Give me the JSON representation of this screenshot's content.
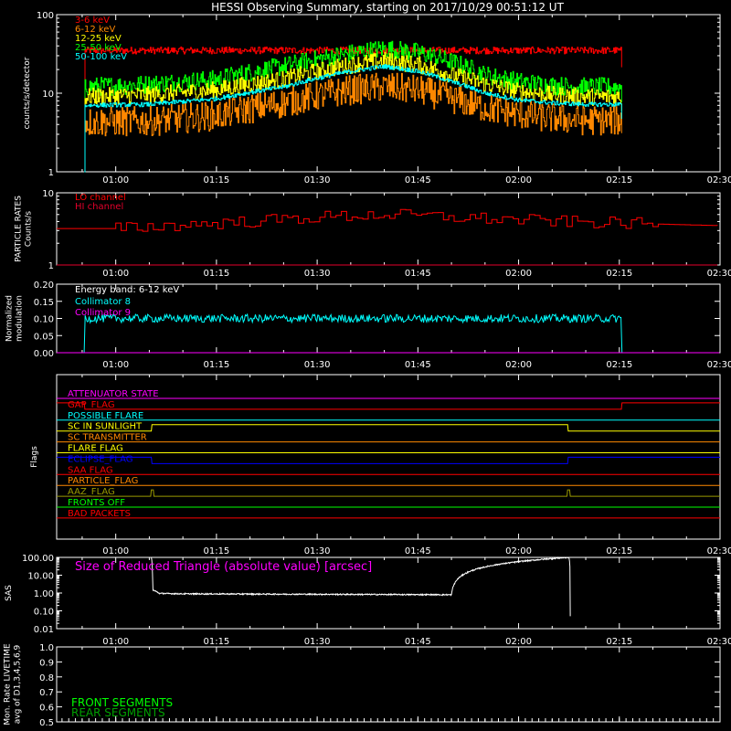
{
  "title": "HESSI Observing Summary, starting on 2017/10/29 00:51:12 UT",
  "time_axis": {
    "start": "00:51:12",
    "end": "02:30",
    "ticks": [
      "01:00",
      "01:15",
      "01:30",
      "01:45",
      "02:00",
      "02:15",
      "02:30"
    ],
    "tick_minutes": [
      60,
      75,
      90,
      105,
      120,
      135,
      150
    ],
    "range_minutes": [
      51.2,
      150
    ]
  },
  "colors": {
    "background": "#000000",
    "axis": "#ffffff",
    "red": "#ff0000",
    "orange": "#ff8800",
    "yellow": "#ffff00",
    "green": "#00ff00",
    "cyan": "#00ffff",
    "magenta": "#ff00ff",
    "crimson": "#e4002b",
    "blue": "#0000ff",
    "olive": "#9a9a00",
    "darkgreen": "#00a000"
  },
  "chart_data": [
    {
      "id": "count-rates",
      "type": "line",
      "ylabel": "counts/s/detector",
      "yscale": "log",
      "ylim": [
        1,
        100
      ],
      "yticks": [
        "1",
        "10",
        "100"
      ],
      "series": [
        {
          "name": "3-6 keV",
          "color": "#ff0000",
          "x": [
            55.3,
            55.4,
            130,
            135.3,
            135.4
          ],
          "y": [
            1,
            35,
            35,
            35,
            1
          ],
          "noise": 0.08
        },
        {
          "name": "6-12 keV",
          "color": "#ff8800",
          "x": [
            55.3,
            55.4,
            65,
            75,
            85,
            95,
            100,
            105,
            110,
            115,
            120,
            125,
            130,
            135.3,
            135.4
          ],
          "y": [
            1,
            4.3,
            4.4,
            5.2,
            7.5,
            11,
            12,
            11,
            8.5,
            6.5,
            5.4,
            4.8,
            4.5,
            4.5,
            1
          ],
          "noise": 0.35
        },
        {
          "name": "12-25 keV",
          "color": "#ffff00",
          "x": [
            55.3,
            55.4,
            65,
            75,
            85,
            95,
            100,
            105,
            110,
            115,
            120,
            125,
            130,
            135.3,
            135.4
          ],
          "y": [
            1,
            9,
            9.5,
            11,
            15,
            23,
            26,
            23,
            17,
            13,
            10.5,
            9.5,
            9,
            9,
            1
          ],
          "noise": 0.2
        },
        {
          "name": "25-50 keV",
          "color": "#00ff00",
          "x": [
            55.3,
            55.4,
            65,
            75,
            85,
            95,
            100,
            105,
            110,
            115,
            120,
            125,
            130,
            135.3,
            135.4
          ],
          "y": [
            1,
            12,
            13,
            15,
            22,
            32,
            37,
            33,
            25,
            17,
            14,
            12.5,
            12,
            12,
            1
          ],
          "noise": 0.22
        },
        {
          "name": "50-100 keV",
          "color": "#00ffff",
          "x": [
            55.3,
            55.4,
            65,
            75,
            85,
            95,
            100,
            105,
            110,
            115,
            120,
            125,
            130,
            135.3,
            135.4
          ],
          "y": [
            1,
            7,
            7.2,
            8.5,
            12,
            19,
            22,
            19,
            14,
            10,
            8.2,
            7.5,
            7.2,
            7.2,
            1
          ],
          "noise": 0.05
        }
      ]
    },
    {
      "id": "particle-rates",
      "type": "line",
      "ylabel": "PARTICLE RATES Counts/s",
      "ylabel_lines": [
        "PARTICLE RATES",
        "Counts/s"
      ],
      "yscale": "log",
      "ylim": [
        1,
        10
      ],
      "yticks": [
        "1",
        "10"
      ],
      "series": [
        {
          "name": "LO channel",
          "color": "#ff0000",
          "x": [
            51.2,
            60,
            65,
            70,
            80,
            90,
            100,
            110,
            120,
            130,
            140,
            150
          ],
          "y": [
            3.2,
            3.2,
            3.4,
            3.6,
            4.0,
            4.6,
            5.0,
            4.6,
            4.2,
            3.9,
            3.7,
            3.5
          ],
          "noise": 0.15
        },
        {
          "name": "HI channel",
          "color": "#e4002b",
          "x": [
            51.2,
            150
          ],
          "y": [
            1,
            1
          ]
        }
      ]
    },
    {
      "id": "modulation",
      "type": "line",
      "ylabel": "Normalized modulation",
      "ylabel_lines": [
        "Normalized",
        "modulation"
      ],
      "ylim": [
        0,
        0.2
      ],
      "yticks": [
        "0.00",
        "0.05",
        "0.10",
        "0.15",
        "0.20"
      ],
      "yvalues": [
        0,
        0.05,
        0.1,
        0.15,
        0.2
      ],
      "energy_band": "Energy band: 6-12 keV",
      "series": [
        {
          "name": "Collimator 8",
          "color": "#00ffff",
          "x": [
            55.3,
            55.4,
            135.3,
            135.4
          ],
          "y": [
            0,
            0.1,
            0.1,
            0
          ],
          "noise": 0.012
        },
        {
          "name": "Collimator 9",
          "color": "#ff00ff",
          "x": [
            51.2,
            150
          ],
          "y": [
            0,
            0
          ]
        }
      ]
    },
    {
      "id": "flags",
      "type": "line",
      "ylabel": "Flags",
      "series": [
        {
          "name": "ATTENUATOR STATE",
          "color": "#ff00ff",
          "x": [
            51.2,
            150
          ],
          "y": [
            0,
            0
          ]
        },
        {
          "name": "GAP_FLAG",
          "color": "#ff0000",
          "x": [
            51.2,
            55.3,
            55.4,
            135.3,
            135.4,
            150
          ],
          "y": [
            1,
            1,
            0,
            0,
            1,
            1
          ]
        },
        {
          "name": "POSSIBLE FLARE",
          "color": "#00ffff",
          "x": [
            51.2,
            150
          ],
          "y": [
            0,
            0
          ]
        },
        {
          "name": "SC IN SUNLIGHT",
          "color": "#ffff00",
          "x": [
            51.2,
            65.3,
            65.4,
            127.3,
            127.4,
            150
          ],
          "y": [
            0,
            0,
            1,
            1,
            0,
            0
          ]
        },
        {
          "name": "SC TRANSMITTER",
          "color": "#ff8800",
          "x": [
            51.2,
            150
          ],
          "y": [
            0,
            0
          ]
        },
        {
          "name": "FLARE FLAG",
          "color": "#ffff00",
          "x": [
            51.2,
            150
          ],
          "y": [
            0,
            0
          ]
        },
        {
          "name": "ECLIPSE_FLAG",
          "color": "#0000ff",
          "x": [
            51.2,
            65.3,
            65.4,
            127.3,
            127.4,
            150
          ],
          "y": [
            1,
            1,
            0,
            0,
            1,
            1
          ]
        },
        {
          "name": "SAA FLAG",
          "color": "#ff0000",
          "x": [
            51.2,
            150
          ],
          "y": [
            0,
            0
          ]
        },
        {
          "name": "PARTICLE_FLAG",
          "color": "#ff8800",
          "x": [
            51.2,
            150
          ],
          "y": [
            0,
            0
          ]
        },
        {
          "name": "AAZ_FLAG",
          "color": "#9a9a00",
          "x": [
            51.2,
            65.2,
            65.3,
            65.6,
            65.7,
            127.2,
            127.3,
            127.6,
            127.7,
            150
          ],
          "y": [
            0,
            0,
            1,
            1,
            0,
            0,
            1,
            1,
            0,
            0
          ]
        },
        {
          "name": "FRONTS OFF",
          "color": "#00ff00",
          "x": [
            51.2,
            150
          ],
          "y": [
            0,
            0
          ]
        },
        {
          "name": "BAD PACKETS",
          "color": "#ff0000",
          "x": [
            51.2,
            150
          ],
          "y": [
            0,
            0
          ]
        }
      ]
    },
    {
      "id": "sas",
      "type": "line",
      "ylabel": "SAS",
      "yscale": "log",
      "ylim": [
        0.01,
        100
      ],
      "yticks": [
        "0.01",
        "0.10",
        "1.00",
        "10.00",
        "100.00"
      ],
      "yvalues": [
        0.01,
        0.1,
        1,
        10,
        100
      ],
      "annotation": "Size of Reduced Triangle (absolute value) [arcsec]",
      "series": [
        {
          "name": "Size of Reduced Triangle",
          "color": "#ffffff",
          "x": [
            65.3,
            65.5,
            66.5,
            70,
            90,
            110,
            127.5,
            127.7
          ],
          "y": [
            100,
            1.5,
            0.95,
            0.9,
            0.85,
            0.8,
            100,
            0.05
          ],
          "noise": 0.06
        }
      ]
    },
    {
      "id": "livetime",
      "type": "line",
      "ylabel": "Mon. Rate LIVETIME avg of D1,3,4,5,6,9",
      "ylabel_lines": [
        "Mon. Rate LIVETIME",
        "avg of D1,3,4,5,6,9"
      ],
      "ylim": [
        0.5,
        1.0
      ],
      "yticks": [
        "0.5",
        "0.6",
        "0.7",
        "0.8",
        "0.9",
        "1.0"
      ],
      "yvalues": [
        0.5,
        0.6,
        0.7,
        0.8,
        0.9,
        1.0
      ],
      "series": [
        {
          "name": "FRONT SEGMENTS",
          "color": "#00ff00",
          "x": [],
          "y": []
        },
        {
          "name": "REAR SEGMENTS",
          "color": "#00a000",
          "x": [],
          "y": []
        }
      ]
    }
  ]
}
